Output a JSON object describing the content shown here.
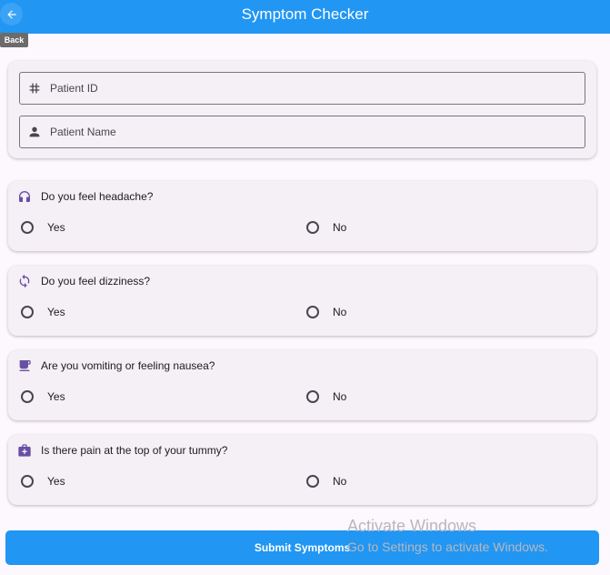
{
  "appbar": {
    "title": "Symptom Checker",
    "back_tooltip": "Back",
    "back_icon": "arrow-left-icon"
  },
  "patient": {
    "id_label": "Patient ID",
    "id_icon": "hash-icon",
    "name_label": "Patient Name",
    "name_icon": "person-icon"
  },
  "questions": [
    {
      "text": "Do you feel headache?",
      "icon": "headphones-icon",
      "yes": "Yes",
      "no": "No"
    },
    {
      "text": "Do you feel dizziness?",
      "icon": "sync-icon",
      "yes": "Yes",
      "no": "No"
    },
    {
      "text": "Are you vomiting or feeling nausea?",
      "icon": "cup-icon",
      "yes": "Yes",
      "no": "No"
    },
    {
      "text": "Is there pain at the top of your tummy?",
      "icon": "medical-bag-icon",
      "yes": "Yes",
      "no": "No"
    }
  ],
  "submit_label": "Submit Symptoms",
  "watermark": {
    "line1": "Activate Windows",
    "line2": "Go to Settings to activate Windows."
  },
  "colors": {
    "primary": "#2196f3",
    "icon_purple": "#6750a4",
    "background": "#fdf7fe",
    "card": "#f5eff6"
  }
}
